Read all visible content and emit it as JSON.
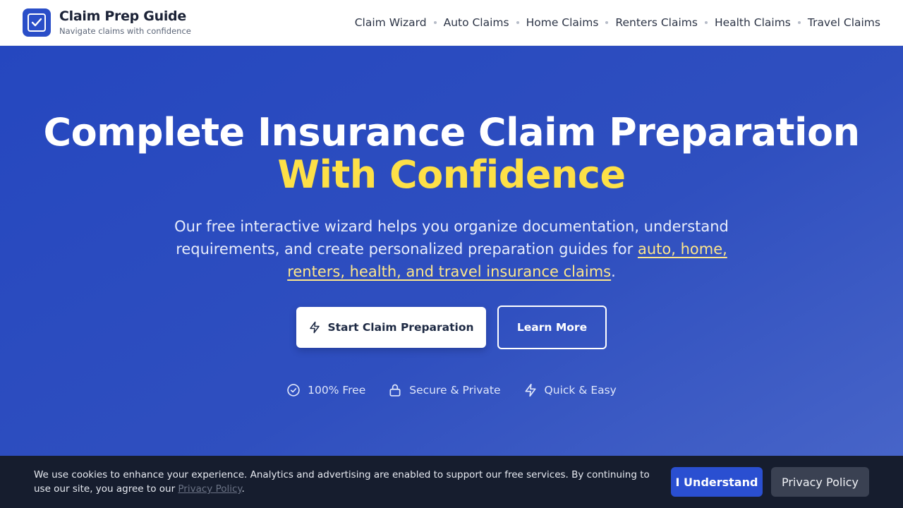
{
  "header": {
    "brand_title": "Claim Prep Guide",
    "brand_tagline": "Navigate claims with confidence",
    "logo_icon": "checkbox-icon",
    "nav": [
      {
        "label": "Claim Wizard"
      },
      {
        "label": "Auto Claims"
      },
      {
        "label": "Home Claims"
      },
      {
        "label": "Renters Claims"
      },
      {
        "label": "Health Claims"
      },
      {
        "label": "Travel Claims"
      }
    ]
  },
  "hero": {
    "title_line1": "Complete Insurance Claim Preparation",
    "title_line2": "With Confidence",
    "description_before": "Our free interactive wizard helps you organize documentation, understand requirements, and create personalized preparation guides for ",
    "description_link": "auto, home, renters, health, and travel insurance claims",
    "description_after": ".",
    "primary_button": "Start Claim Preparation",
    "primary_button_icon": "lightning-icon",
    "secondary_button": "Learn More",
    "features": [
      {
        "label": "100% Free",
        "icon": "check-circle-icon"
      },
      {
        "label": "Secure & Private",
        "icon": "lock-icon"
      },
      {
        "label": "Quick & Easy",
        "icon": "lightning-icon"
      }
    ]
  },
  "cookie_banner": {
    "text": "We use cookies to enhance your experience. Analytics and advertising are enabled to support our free services. By continuing to use our site, you agree to our ",
    "link": "Privacy Policy",
    "text_end": ".",
    "accept_button": "I Understand",
    "policy_button": "Privacy Policy"
  },
  "colors": {
    "brand_blue": "#2a4ec8",
    "accent_yellow": "#fde047",
    "link_yellow": "#fde68a",
    "banner_bg": "#161d2e"
  }
}
